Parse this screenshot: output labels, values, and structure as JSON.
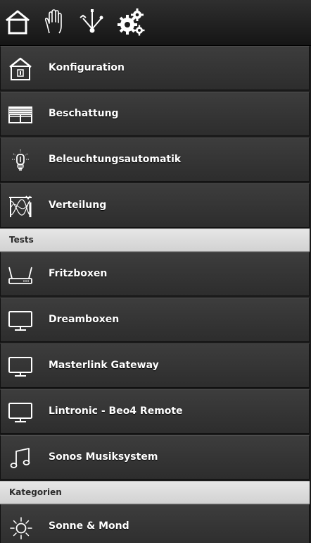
{
  "toolbar": {
    "items": [
      {
        "icon": "home-icon"
      },
      {
        "icon": "hand-icon"
      },
      {
        "icon": "network-icon"
      },
      {
        "icon": "gears-icon"
      }
    ]
  },
  "menu": {
    "items": [
      {
        "label": "Konfiguration",
        "icon": "house-config-icon"
      },
      {
        "label": "Beschattung",
        "icon": "shutter-icon"
      },
      {
        "label": "Beleuchtungsautomatik",
        "icon": "bulb-icon"
      },
      {
        "label": "Verteilung",
        "icon": "distribution-icon"
      }
    ]
  },
  "sections": {
    "tests": {
      "title": "Tests",
      "items": [
        {
          "label": "Fritzboxen",
          "icon": "router-icon"
        },
        {
          "label": "Dreamboxen",
          "icon": "monitor-icon"
        },
        {
          "label": "Masterlink Gateway",
          "icon": "monitor-icon"
        },
        {
          "label": "Lintronic - Beo4 Remote",
          "icon": "monitor-icon"
        },
        {
          "label": "Sonos Musiksystem",
          "icon": "music-note-icon"
        }
      ]
    },
    "kategorien": {
      "title": "Kategorien",
      "items": [
        {
          "label": "Sonne & Mond",
          "icon": "sun-icon"
        }
      ]
    }
  }
}
